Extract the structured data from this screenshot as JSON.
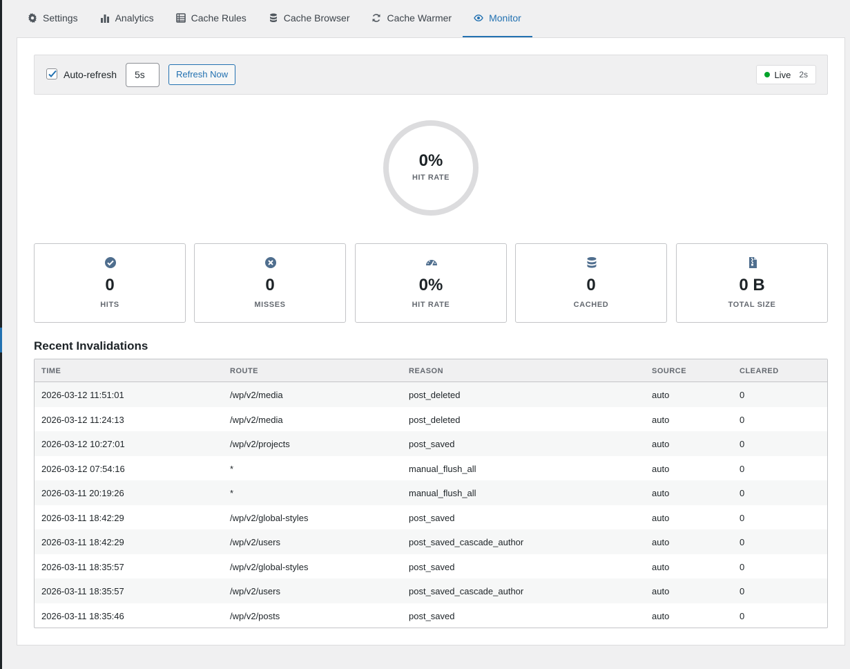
{
  "tabs": [
    {
      "label": "Settings",
      "icon": "gear-icon"
    },
    {
      "label": "Analytics",
      "icon": "bar-chart-icon"
    },
    {
      "label": "Cache Rules",
      "icon": "list-icon"
    },
    {
      "label": "Cache Browser",
      "icon": "database-icon"
    },
    {
      "label": "Cache Warmer",
      "icon": "refresh-icon"
    },
    {
      "label": "Monitor",
      "icon": "eye-icon",
      "active": true
    }
  ],
  "toolbar": {
    "auto_refresh_label": "Auto-refresh",
    "auto_refresh_checked": true,
    "interval_value": "5s",
    "refresh_button_label": "Refresh Now",
    "live_label": "Live",
    "live_seconds": "2s"
  },
  "gauge": {
    "value": "0%",
    "label": "HIT RATE",
    "fill_fraction": 0
  },
  "stats": [
    {
      "icon": "check-circle-icon",
      "value": "0",
      "label": "HITS"
    },
    {
      "icon": "x-circle-icon",
      "value": "0",
      "label": "MISSES"
    },
    {
      "icon": "speedometer-icon",
      "value": "0%",
      "label": "HIT RATE"
    },
    {
      "icon": "database-icon",
      "value": "0",
      "label": "CACHED"
    },
    {
      "icon": "zip-file-icon",
      "value": "0 B",
      "label": "TOTAL SIZE"
    }
  ],
  "invalidations": {
    "title": "Recent Invalidations",
    "columns": [
      "TIME",
      "ROUTE",
      "REASON",
      "SOURCE",
      "CLEARED"
    ],
    "rows": [
      [
        "2026-03-12 11:51:01",
        "/wp/v2/media",
        "post_deleted",
        "auto",
        "0"
      ],
      [
        "2026-03-12 11:24:13",
        "/wp/v2/media",
        "post_deleted",
        "auto",
        "0"
      ],
      [
        "2026-03-12 10:27:01",
        "/wp/v2/projects",
        "post_saved",
        "auto",
        "0"
      ],
      [
        "2026-03-12 07:54:16",
        "*",
        "manual_flush_all",
        "auto",
        "0"
      ],
      [
        "2026-03-11 20:19:26",
        "*",
        "manual_flush_all",
        "auto",
        "0"
      ],
      [
        "2026-03-11 18:42:29",
        "/wp/v2/global-styles",
        "post_saved",
        "auto",
        "0"
      ],
      [
        "2026-03-11 18:42:29",
        "/wp/v2/users",
        "post_saved_cascade_author",
        "auto",
        "0"
      ],
      [
        "2026-03-11 18:35:57",
        "/wp/v2/global-styles",
        "post_saved",
        "auto",
        "0"
      ],
      [
        "2026-03-11 18:35:57",
        "/wp/v2/users",
        "post_saved_cascade_author",
        "auto",
        "0"
      ],
      [
        "2026-03-11 18:35:46",
        "/wp/v2/posts",
        "post_saved",
        "auto",
        "0"
      ]
    ]
  },
  "colors": {
    "accent": "#2271b1",
    "live_dot": "#00a32a",
    "icon": "#4f6e8e"
  }
}
